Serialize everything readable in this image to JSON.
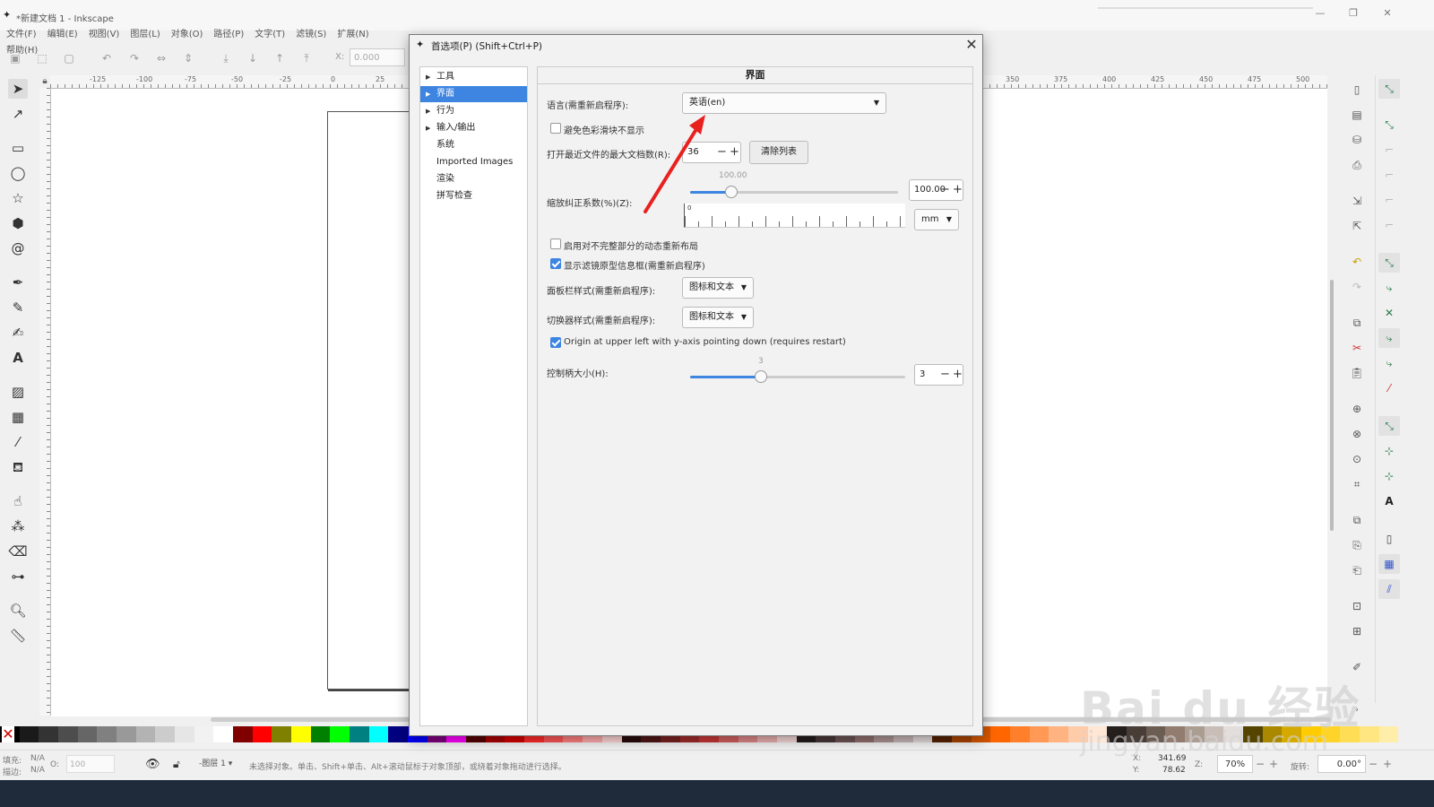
{
  "app": {
    "title": "*新建文档 1 - Inkscape",
    "logo_icon": "inkscape-logo-icon",
    "window_controls": {
      "minimize": "—",
      "restore": "❐",
      "close": "✕"
    }
  },
  "menu": [
    "文件(F)",
    "编辑(E)",
    "视图(V)",
    "图层(L)",
    "对象(O)",
    "路径(P)",
    "文字(T)",
    "滤镜(S)",
    "扩展(N)",
    "帮助(H)"
  ],
  "toolbar": {
    "x_label": "X:",
    "x_value": "0.000"
  },
  "ruler_top": [
    "-125",
    "-100",
    "-75",
    "-50",
    "-25",
    "0",
    "25",
    "350",
    "375",
    "400",
    "425",
    "450",
    "475",
    "500"
  ],
  "dialog": {
    "title": "首选项(P) (Shift+Ctrl+P)",
    "close": "✕",
    "tree": [
      {
        "label": "工具",
        "expandable": true,
        "selected": false
      },
      {
        "label": "界面",
        "expandable": true,
        "selected": true
      },
      {
        "label": "行为",
        "expandable": true,
        "selected": false
      },
      {
        "label": "输入/输出",
        "expandable": true,
        "selected": false
      },
      {
        "label": "系统",
        "expandable": false,
        "selected": false
      },
      {
        "label": "Imported Images",
        "expandable": false,
        "selected": false
      },
      {
        "label": "渲染",
        "expandable": false,
        "selected": false
      },
      {
        "label": "拼写检查",
        "expandable": false,
        "selected": false
      }
    ],
    "panel": {
      "title": "界面",
      "language_label": "语言(需重新启程序):",
      "language_value": "英语(en)",
      "avoid_color_label": "避免色彩滑块不显示",
      "avoid_color_checked": false,
      "recent_label": "打开最近文件的最大文档数(R):",
      "recent_value": "36",
      "clear_list": "清除列表",
      "zoom_value_above": "100.00",
      "zoom_label": "缩放纠正系数(%)(Z):",
      "zoom_value": "100.00",
      "zoom_fraction": 0.2,
      "ruler_zero": "0",
      "unit": "mm",
      "dynamic_relayout_label": "启用对不完整部分的动态重新布局",
      "dynamic_relayout_checked": false,
      "filter_info_label": "显示滤镜原型信息框(需重新启程序)",
      "filter_info_checked": true,
      "dock_style_label": "面板栏样式(需重新启程序):",
      "dock_style_value": "图标和文本",
      "switcher_style_label": "切换器样式(需重新启程序):",
      "switcher_style_value": "图标和文本",
      "origin_label": "Origin at upper left with y-axis pointing down (requires restart)",
      "origin_checked": true,
      "handle_value_above": "3",
      "handle_label": "控制柄大小(H):",
      "handle_value": "3",
      "handle_fraction": 0.33
    }
  },
  "status": {
    "fill_label": "填充:",
    "fill_value": "N/A",
    "stroke_label": "描边:",
    "stroke_value": "N/A",
    "opacity_label": "O:",
    "opacity_value": "100",
    "layer": "-图层 1 ▾",
    "message": "未选择对象。单击、Shift+单击、Alt+滚动鼠标于对象顶部，或绕着对象拖动进行选择。",
    "x_label": "X:",
    "x_value": "341.69",
    "y_label": "Y:",
    "y_value": "78.62",
    "z_label": "Z:",
    "zoom": "70%",
    "rot_label": "旋转:",
    "rotation": "0.00°"
  },
  "watermark": {
    "main": "Bai du 经验",
    "sub": "jingyan.baidu.com"
  },
  "colors": {
    "accent": "#3d85e0",
    "arrow": "#e8211f"
  }
}
